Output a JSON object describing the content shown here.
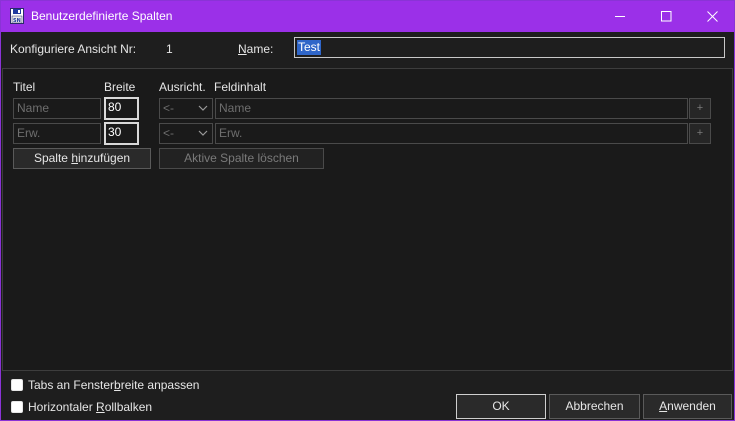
{
  "window": {
    "title": "Benutzerdefinierte Spalten",
    "icon": "floppy-list-icon",
    "accent_color": "#9b30e8",
    "controls": {
      "minimize": "minimize-icon",
      "maximize": "maximize-icon",
      "close": "close-icon"
    }
  },
  "header": {
    "configure_label": "Konfiguriere Ansicht Nr:",
    "view_number": "1",
    "name_label": "Name:",
    "name_value": "Test"
  },
  "columns_header": {
    "title": "Titel",
    "width": "Breite",
    "alignment": "Ausricht.",
    "field_content": "Feldinhalt"
  },
  "rows": [
    {
      "title_placeholder": "Name",
      "width": "80",
      "alignment": "<-",
      "field_content_placeholder": "Name",
      "plus": "+"
    },
    {
      "title_placeholder": "Erw.",
      "width": "30",
      "alignment": "<-",
      "field_content_placeholder": "Erw.",
      "plus": "+"
    }
  ],
  "actions": {
    "add_column_pre": "Spalte ",
    "add_column_u": "h",
    "add_column_post": "inzufügen",
    "delete_column": "Aktive Spalte löschen"
  },
  "options": {
    "fit_tabs_pre": "Tabs an Fenster",
    "fit_tabs_u": "b",
    "fit_tabs_post": "reite anpassen",
    "fit_tabs_checked": false,
    "hscroll_pre": "Horizontaler ",
    "hscroll_u": "R",
    "hscroll_post": "ollbalken",
    "hscroll_checked": false
  },
  "buttons": {
    "ok": "OK",
    "cancel": "Abbrechen",
    "apply_u": "A",
    "apply_post": "nwenden"
  }
}
